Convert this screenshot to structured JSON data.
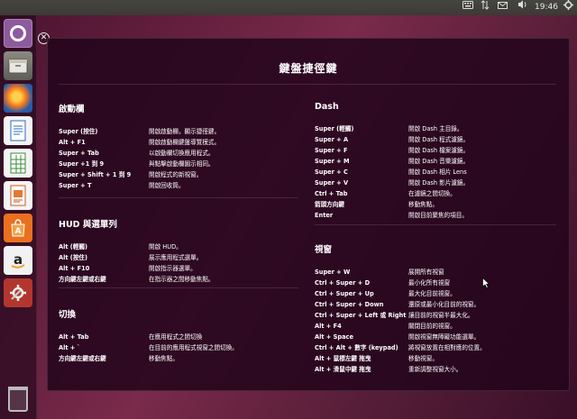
{
  "panel": {
    "keyboard_icon": "keyboard-icon",
    "network_icon": "network-updown-icon",
    "mail_icon": "envelope-icon",
    "volume_icon": "speaker-icon",
    "clock": "19:46",
    "settings_icon": "gear-icon"
  },
  "launcher": {
    "items": [
      "dash-home",
      "files",
      "firefox",
      "libreoffice-writer",
      "libreoffice-calc",
      "libreoffice-impress",
      "ubuntu-software",
      "amazon",
      "system-settings",
      "trash"
    ]
  },
  "overlay": {
    "title": "鍵盤捷徑鍵",
    "sections": {
      "launcher": {
        "title": "啟動欄",
        "rows": [
          {
            "key": "Super (按住)",
            "desc": "開啟啟動欄，顯示捷徑鍵。"
          },
          {
            "key": "Alt + F1",
            "desc": "開啟啟動欄鍵盤導覽模式。"
          },
          {
            "key": "Super + Tab",
            "desc": "以啟動欄切換應用程式。"
          },
          {
            "key": "Super +1 到 9",
            "desc": "與點擊啟動欄圖示相同。"
          },
          {
            "key": "Super + Shift + 1 到 9",
            "desc": "開啟程式的新視窗。"
          },
          {
            "key": "Super + T",
            "desc": "開啟回收筒。"
          }
        ]
      },
      "hud": {
        "title": "HUD 與選單列",
        "rows": [
          {
            "key": "Alt (輕觸)",
            "desc": "開啟 HUD。"
          },
          {
            "key": "Alt (按住)",
            "desc": "展示應用程式選單。"
          },
          {
            "key": "Alt + F10",
            "desc": "開啟指示器選單。"
          },
          {
            "key": "方向鍵左鍵或右鍵",
            "desc": "在指示器之間移動焦點。"
          }
        ]
      },
      "switching": {
        "title": "切換",
        "rows": [
          {
            "key": "Alt + Tab",
            "desc": "在應用程式之間切換"
          },
          {
            "key": "Alt + `",
            "desc": "在目前的應用程式視窗之間切換。"
          },
          {
            "key": "方向鍵左鍵或右鍵",
            "desc": "移動焦點。"
          }
        ]
      },
      "dash": {
        "title": "Dash",
        "rows": [
          {
            "key": "Super (輕觸)",
            "desc": "開啟 Dash 主目錄。"
          },
          {
            "key": "Super + A",
            "desc": "開啟 Dash 程式濾鏡。"
          },
          {
            "key": "Super + F",
            "desc": "開啟 Dash 檔案濾鏡。"
          },
          {
            "key": "Super + M",
            "desc": "開啟 Dash 音樂濾鏡。"
          },
          {
            "key": "Super + C",
            "desc": "開啟 Dash 相片 Lens"
          },
          {
            "key": "Super + V",
            "desc": "開啟 Dash 影片濾鏡。"
          },
          {
            "key": "Ctrl + Tab",
            "desc": "在濾鏡之間切換。"
          },
          {
            "key": "箭頭方向鍵",
            "desc": "移動焦點。"
          },
          {
            "key": "Enter",
            "desc": "開啟目前聚焦的項目。"
          }
        ]
      },
      "window": {
        "title": "視窗",
        "rows": [
          {
            "key": "Super + W",
            "desc": "展開所有視窗"
          },
          {
            "key": "Ctrl + Super + D",
            "desc": "最小化所有視窗"
          },
          {
            "key": "Ctrl + Super + Up",
            "desc": "最大化目前視窗。"
          },
          {
            "key": "Ctrl + Super + Down",
            "desc": "還原或最小化目前的視窗。"
          },
          {
            "key": "Ctrl + Super + Left 或 Right",
            "desc": "讓目前的視窗半最大化。"
          },
          {
            "key": "Alt + F4",
            "desc": "關閉目前的視窗。"
          },
          {
            "key": "Alt + Space",
            "desc": "開啟視窗無障礙功能選單。"
          },
          {
            "key": "Ctrl + Alt + 數字 (keypad)",
            "desc": "將視窗放置在相對應的位置。"
          },
          {
            "key": "Alt + 鼠標左鍵 拖曳",
            "desc": "移動視窗。"
          },
          {
            "key": "Alt + 滑鼠中鍵 拖曳",
            "desc": "重新調整視窗大小。"
          }
        ]
      }
    }
  }
}
